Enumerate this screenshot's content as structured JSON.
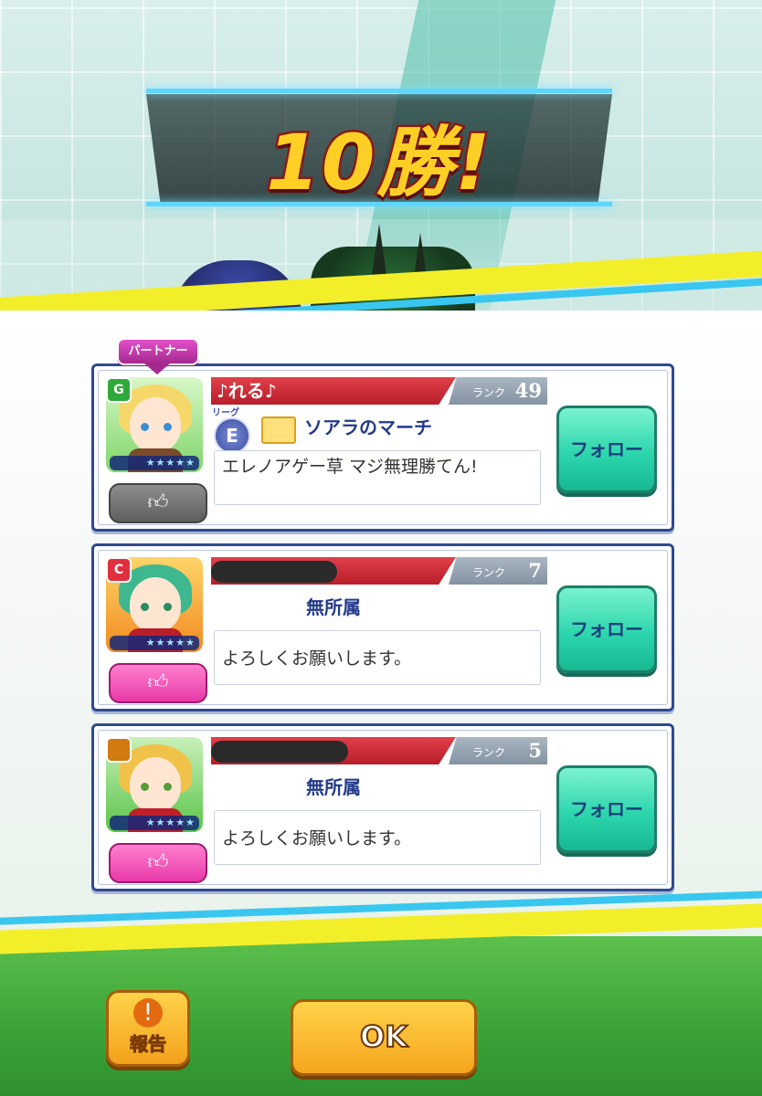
{
  "banner": {
    "text": "10勝!"
  },
  "partner_tag": "パートナー",
  "players": [
    {
      "name": "♪れる♪",
      "rank_label": "ランク",
      "rank": "49",
      "league_tag": "リーグ",
      "league": "E",
      "guild": "ソアラのマーチ",
      "comment": "エレノアゲー草 マジ無理勝てん!",
      "rarity": "G",
      "rarity_color": "#2faa3a",
      "follow_label": "フォロー",
      "like_icon": "thumbs-up-icon",
      "liked": false
    },
    {
      "name": "",
      "rank_label": "ランク",
      "rank": "7",
      "guild": "無所属",
      "comment": "よろしくお願いします。",
      "rarity": "C",
      "rarity_color": "#e0303e",
      "follow_label": "フォロー",
      "like_icon": "thumbs-up-icon",
      "liked": true
    },
    {
      "name": "",
      "rank_label": "ランク",
      "rank": "5",
      "guild": "無所属",
      "comment": "よろしくお願いします。",
      "rarity": "",
      "rarity_color": "#d07a10",
      "follow_label": "フォロー",
      "like_icon": "thumbs-up-icon",
      "liked": true
    }
  ],
  "buttons": {
    "report": "報告",
    "ok": "OK"
  },
  "colors": {
    "follow": "#2dd6ad",
    "like_on": "#e83aa8",
    "banner": "#ffcf26"
  }
}
